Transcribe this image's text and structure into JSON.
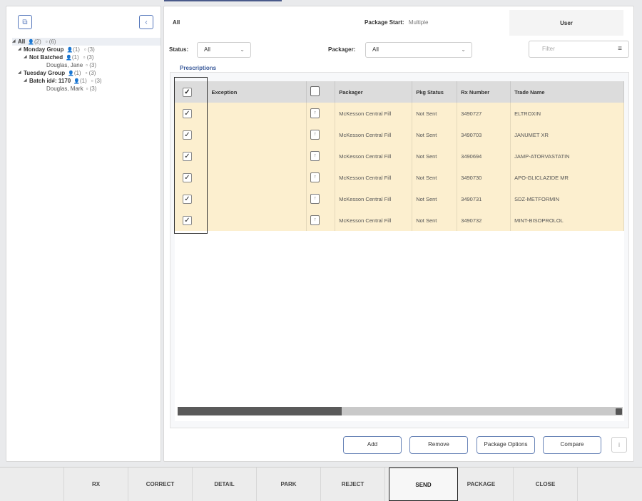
{
  "tree": [
    {
      "label": "All",
      "count_user": "(2)",
      "count_rx": "(6)",
      "level": 0,
      "selected": true,
      "has_arrow": true
    },
    {
      "label": "Monday Group",
      "count_user": "(1)",
      "count_rx": "(3)",
      "level": 1,
      "has_arrow": true
    },
    {
      "label": "Not Batched",
      "count_user": "(1)",
      "count_rx": "(3)",
      "level": 2,
      "has_arrow": true
    },
    {
      "label": "Douglas, Jane",
      "count_rx": "(3)",
      "level": 3,
      "leaf": true
    },
    {
      "label": "Tuesday Group",
      "count_user": "(1)",
      "count_rx": "(3)",
      "level": 1,
      "has_arrow": true
    },
    {
      "label": "Batch id#: 1170",
      "count_user": "(1)",
      "count_rx": "(3)",
      "level": 2,
      "has_arrow": true
    },
    {
      "label": "Douglas, Mark",
      "count_rx": "(3)",
      "level": 3,
      "leaf": true
    }
  ],
  "header": {
    "scope": "All",
    "package_start_label": "Package Start:",
    "package_start_value": "Multiple",
    "user_label": "User"
  },
  "filters": {
    "status_label": "Status:",
    "status_value": "All",
    "packager_label": "Packager:",
    "packager_value": "All",
    "filter_placeholder": "Filter"
  },
  "tab_label": "Prescriptions",
  "columns": [
    "Exception",
    "Packager",
    "Pkg Status",
    "Rx Number",
    "Trade Name"
  ],
  "rows": [
    {
      "exception": "",
      "packager": "McKesson Central Fill",
      "pkg_status": "Not Sent",
      "rx_number": "3490727",
      "trade_name": "ELTROXIN"
    },
    {
      "exception": "",
      "packager": "McKesson Central Fill",
      "pkg_status": "Not Sent",
      "rx_number": "3490703",
      "trade_name": "JANUMET XR"
    },
    {
      "exception": "",
      "packager": "McKesson Central Fill",
      "pkg_status": "Not Sent",
      "rx_number": "3490694",
      "trade_name": "JAMP-ATORVASTATIN"
    },
    {
      "exception": "",
      "packager": "McKesson Central Fill",
      "pkg_status": "Not Sent",
      "rx_number": "3490730",
      "trade_name": "APO-GLICLAZIDE MR"
    },
    {
      "exception": "",
      "packager": "McKesson Central Fill",
      "pkg_status": "Not Sent",
      "rx_number": "3490731",
      "trade_name": "SDZ-METFORMIN"
    },
    {
      "exception": "",
      "packager": "McKesson Central Fill",
      "pkg_status": "Not Sent",
      "rx_number": "3490732",
      "trade_name": "MINT-BISOPROLOL"
    }
  ],
  "actions": {
    "add": "Add",
    "remove": "Remove",
    "package_options": "Package Options",
    "compare": "Compare",
    "info": "i"
  },
  "bottom_nav": [
    "RX",
    "CORRECT",
    "DETAIL",
    "PARK",
    "REJECT",
    "SEND",
    "PACKAGE",
    "CLOSE"
  ],
  "bottom_active": "SEND"
}
